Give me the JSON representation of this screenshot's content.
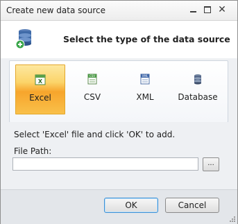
{
  "window": {
    "title": "Create new data source"
  },
  "header": {
    "title": "Select the type of the data source"
  },
  "types": [
    {
      "label": "Excel",
      "icon": "excel-icon",
      "selected": true
    },
    {
      "label": "CSV",
      "icon": "csv-icon",
      "selected": false
    },
    {
      "label": "XML",
      "icon": "xml-icon",
      "selected": false
    },
    {
      "label": "Database",
      "icon": "database-icon",
      "selected": false
    }
  ],
  "form": {
    "instruction": "Select 'Excel' file and click 'OK' to add.",
    "file_path_label": "File Path:",
    "file_path_value": "",
    "browse_label": "..."
  },
  "buttons": {
    "ok_label": "OK",
    "cancel_label": "Cancel"
  },
  "colors": {
    "selected_tile": "#f7a52c",
    "ok_border": "#3c8fd4"
  }
}
